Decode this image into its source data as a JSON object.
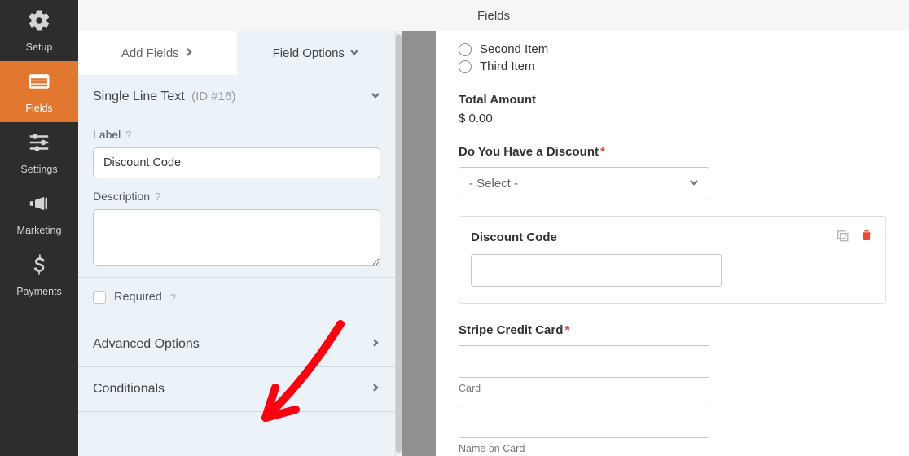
{
  "nav": {
    "items": [
      {
        "name": "setup",
        "label": "Setup"
      },
      {
        "name": "fields",
        "label": "Fields"
      },
      {
        "name": "settings",
        "label": "Settings"
      },
      {
        "name": "marketing",
        "label": "Marketing"
      },
      {
        "name": "payments",
        "label": "Payments"
      }
    ]
  },
  "topbar": {
    "title": "Fields"
  },
  "tabs": {
    "add": "Add Fields",
    "options": "Field Options"
  },
  "field": {
    "type_name": "Single Line Text",
    "id_label": "(ID #16)",
    "label_caption": "Label",
    "label_value": "Discount Code",
    "desc_caption": "Description",
    "desc_value": "",
    "required_caption": "Required"
  },
  "accordions": {
    "advanced": "Advanced Options",
    "conditionals": "Conditionals"
  },
  "preview": {
    "radio1": "Second Item",
    "radio2": "Third Item",
    "total_label": "Total Amount",
    "total_value": "$ 0.00",
    "discount_q_label": "Do You Have a Discount",
    "select_placeholder": "- Select -",
    "discount_code_label": "Discount Code",
    "stripe_label": "Stripe Credit Card",
    "card_sublabel": "Card",
    "name_sublabel": "Name on Card"
  }
}
